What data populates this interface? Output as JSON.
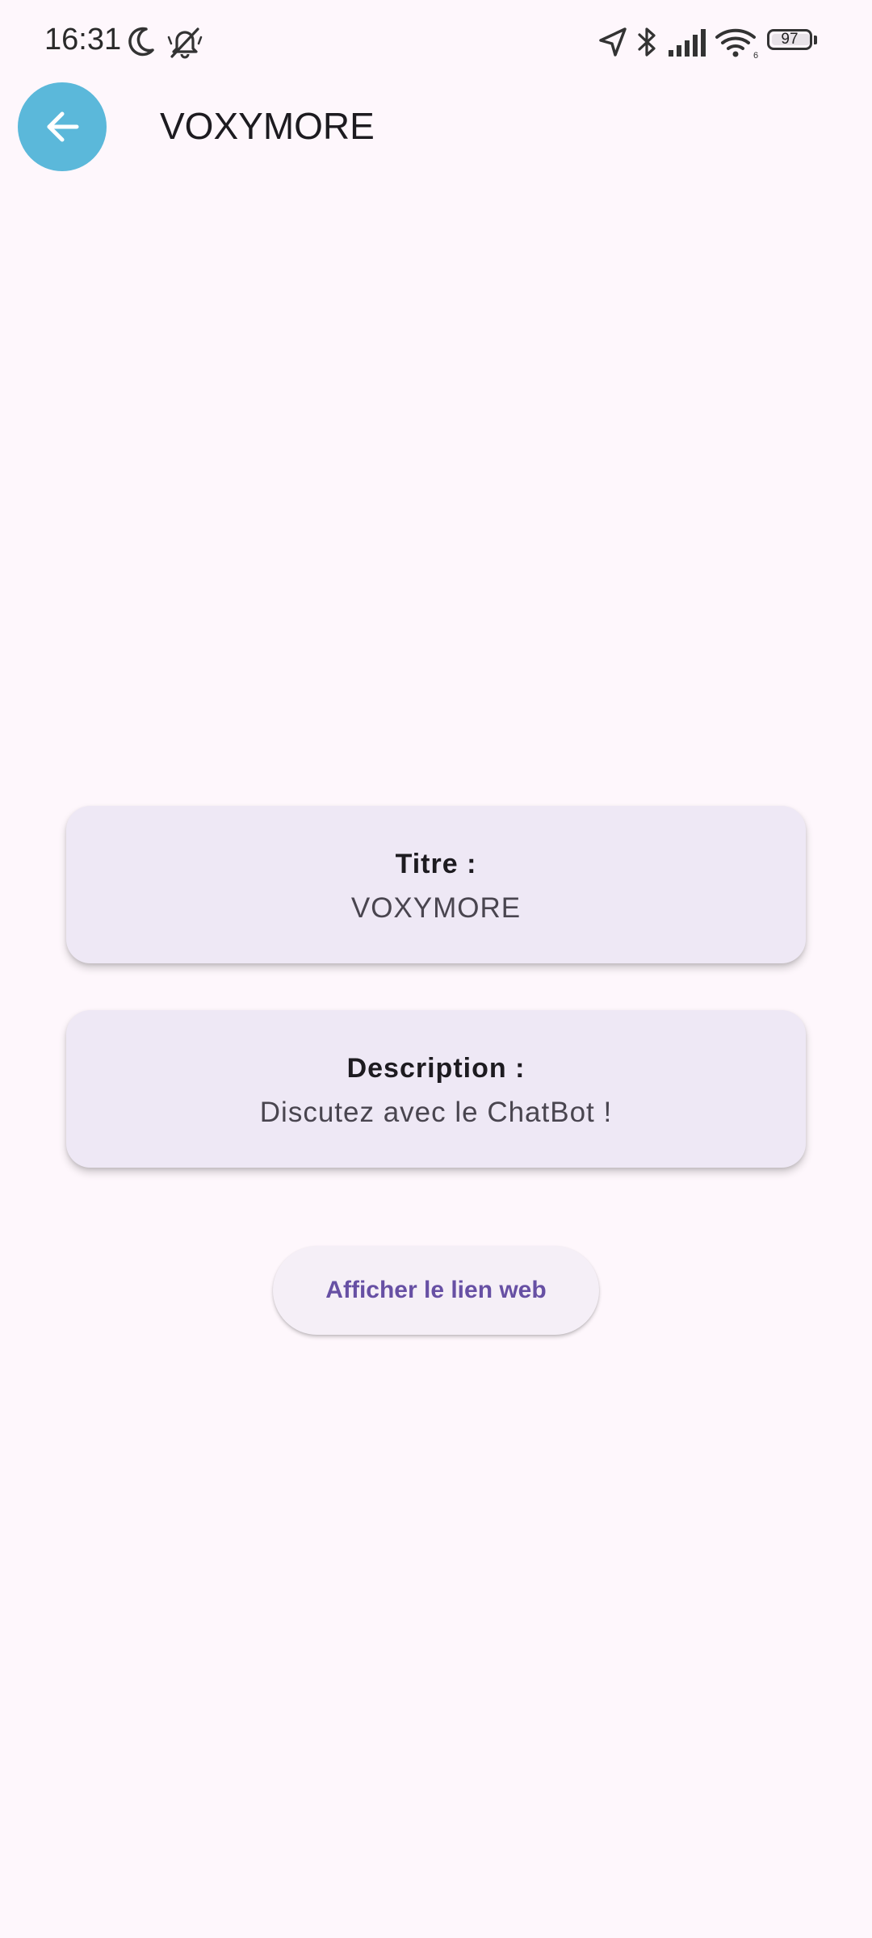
{
  "status_bar": {
    "time": "16:31",
    "battery_level": "97",
    "icons": [
      "moon-icon",
      "bell-off-icon",
      "location-icon",
      "bluetooth-icon",
      "signal-icon",
      "wifi-icon",
      "battery-icon"
    ]
  },
  "app_bar": {
    "title": "VOXYMORE",
    "back_icon": "arrow-back-icon",
    "back_button_color": "#5BB8DA"
  },
  "cards": {
    "title": {
      "label": "Titre :",
      "value": "VOXYMORE"
    },
    "description": {
      "label": "Description :",
      "value": "Discutez avec le ChatBot !"
    }
  },
  "actions": {
    "web_link_label": "Afficher le lien web",
    "accent_color": "#6750A4"
  },
  "colors": {
    "background": "#FEF7FC",
    "card_background": "#EEE8F5"
  }
}
